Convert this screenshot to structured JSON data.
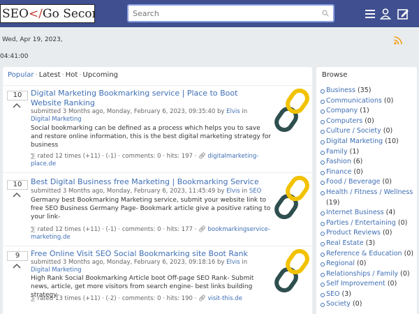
{
  "header": {
    "logo_text_a": "SEO ",
    "logo_text_b": "</",
    "logo_text_c": "Go Second",
    "logo_text_d": ">",
    "search_placeholder": "Search",
    "icons": [
      "menu-icon",
      "user-icon",
      "edit-icon"
    ]
  },
  "datebar": {
    "date": "Wed, Apr 19, 2023,",
    "time": "04:41:00"
  },
  "tabs": [
    "Popular",
    "Latest",
    "Hot",
    "Upcoming"
  ],
  "items": [
    {
      "score": "10",
      "title": "Digital Marketing Bookmarking service | Place to Boot Website Ranking",
      "submitted": "submitted 3 Months ago, Monday, February 6, 2023, 09:35:40 by",
      "author": "Elvis",
      "in": "in",
      "category": "Digital Marketing",
      "desc": "Social bookmarking can be defined as a process which helps you to save and restore online information, this is the best digital marketing strategy for business",
      "stats": "rated 12 times (+11) · (-1) · comments: 0 · hits: 197 ·",
      "link": "digitalmarketing-place.de"
    },
    {
      "score": "10",
      "title": "Best Digital Business free Marketing | Bookmarking Service",
      "submitted": "submitted 3 Months ago, Monday, February 6, 2023, 11:45:49 by",
      "author": "Elvis",
      "in": "in",
      "category": "SEO",
      "desc": "Germany best Bookmarking Marketing service, submit your website link to free SEO Business Germany Page- Bookmark article give a positive rating to your link-",
      "stats": "rated 12 times (+11) · (-1) · comments: 0 · hits: 177 ·",
      "link": "bookmarkingservice-marketing.de"
    },
    {
      "score": "9",
      "title": "Free Online Visit SEO Social Bookmarking site Boot Rank",
      "submitted": "submitted 3 Months ago, Monday, February 6, 2023, 09:18:16 by",
      "author": "Elvis",
      "in": "in",
      "category": "Digital Marketing",
      "desc": "High Rank Social Bookmarking Article boot Off-page SEO Rank- Submit news, article, get more visitors from search engine- best links building strategy-",
      "stats": "rated 13 times (+11) · (-2) · comments: 0 · hits: 190 ·",
      "link": "visit-this.de"
    }
  ],
  "sidebar": {
    "heading": "Browse",
    "categories": [
      {
        "name": "Business",
        "count": "(35)"
      },
      {
        "name": "Communications",
        "count": "(0)"
      },
      {
        "name": "Company",
        "count": "(1)"
      },
      {
        "name": "Computers",
        "count": "(0)"
      },
      {
        "name": "Culture / Society",
        "count": "(0)"
      },
      {
        "name": "Digital Marketing",
        "count": "(10)"
      },
      {
        "name": "Family",
        "count": "(1)"
      },
      {
        "name": "Fashion",
        "count": "(6)"
      },
      {
        "name": "Finance",
        "count": "(0)"
      },
      {
        "name": "Food / Beverage",
        "count": "(0)"
      },
      {
        "name": "Health / Fitness / Wellness",
        "count": "(19)"
      },
      {
        "name": "Internet Business",
        "count": "(4)"
      },
      {
        "name": "Parties / Entertaining",
        "count": "(0)"
      },
      {
        "name": "Product Reviews",
        "count": "(0)"
      },
      {
        "name": "Real Estate",
        "count": "(3)"
      },
      {
        "name": "Reference & Education",
        "count": "(0)"
      },
      {
        "name": "Regional",
        "count": "(0)"
      },
      {
        "name": "Relationships / Family",
        "count": "(0)"
      },
      {
        "name": "Self Improvement",
        "count": "(0)"
      },
      {
        "name": "SEO",
        "count": "(3)"
      },
      {
        "name": "Society",
        "count": "(0)"
      }
    ]
  },
  "colors": {
    "header_bg": "#3f4f8f",
    "link": "#3f6fb5",
    "rss": "#f39c12"
  }
}
